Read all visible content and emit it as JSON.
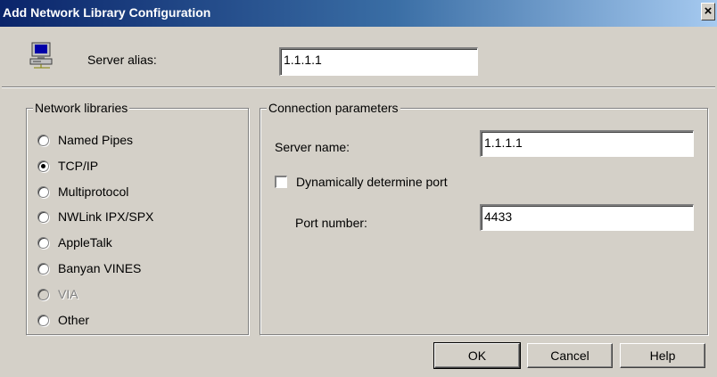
{
  "window": {
    "title": "Add Network Library Configuration",
    "close_glyph": "×"
  },
  "server_alias": {
    "label": "Server alias:",
    "value": "1.1.1.1",
    "icon": "computer-icon"
  },
  "network_libraries": {
    "legend": "Network libraries",
    "options": [
      {
        "label": "Named Pipes",
        "selected": false,
        "enabled": true
      },
      {
        "label": "TCP/IP",
        "selected": true,
        "enabled": true
      },
      {
        "label": "Multiprotocol",
        "selected": false,
        "enabled": true
      },
      {
        "label": "NWLink IPX/SPX",
        "selected": false,
        "enabled": true
      },
      {
        "label": "AppleTalk",
        "selected": false,
        "enabled": true
      },
      {
        "label": "Banyan VINES",
        "selected": false,
        "enabled": true
      },
      {
        "label": "VIA",
        "selected": false,
        "enabled": false
      },
      {
        "label": "Other",
        "selected": false,
        "enabled": true
      }
    ]
  },
  "connection_parameters": {
    "legend": "Connection parameters",
    "server_name_label": "Server name:",
    "server_name_value": "1.1.1.1",
    "dynamic_port_label": "Dynamically determine port",
    "dynamic_port_checked": false,
    "port_label": "Port number:",
    "port_value": "4433"
  },
  "buttons": {
    "ok": "OK",
    "cancel": "Cancel",
    "help": "Help"
  }
}
